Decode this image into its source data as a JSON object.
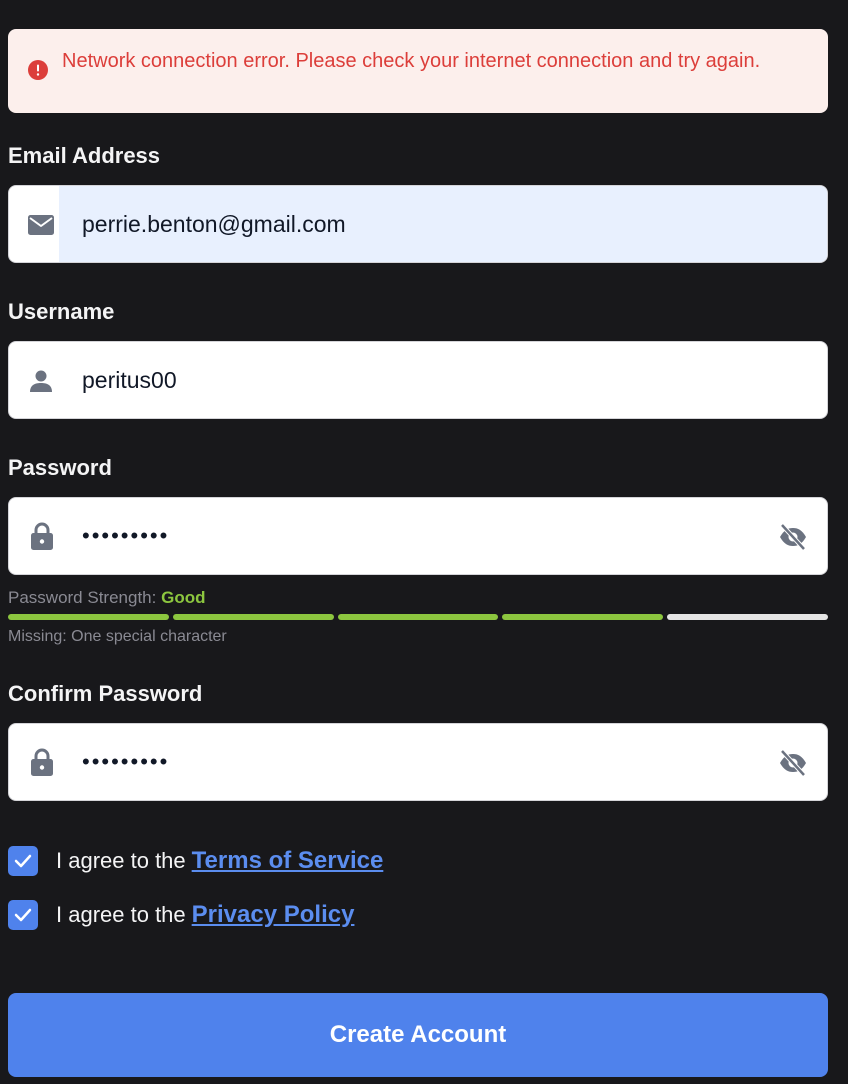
{
  "alert": {
    "message": "Network connection error. Please check your internet connection and try again.",
    "icon": "error-circle-icon",
    "color": "#dc3e3a",
    "background": "#fcefec"
  },
  "form": {
    "email": {
      "label": "Email Address",
      "value": "perrie.benton@gmail.com",
      "icon": "mail-icon"
    },
    "username": {
      "label": "Username",
      "value": "peritus00",
      "icon": "person-icon"
    },
    "password": {
      "label": "Password",
      "value": "•••••••••",
      "icon": "lock-icon",
      "toggle_icon": "eye-off-icon"
    },
    "strength": {
      "label": "Password Strength:",
      "value": "Good",
      "segments_total": 5,
      "segments_filled": 4,
      "missing": "Missing: One special character",
      "color": "#8cc63f"
    },
    "confirm_password": {
      "label": "Confirm Password",
      "value": "•••••••••",
      "icon": "lock-icon",
      "toggle_icon": "eye-off-icon"
    },
    "terms": {
      "checked": true,
      "prefix": "I agree to the",
      "link": "Terms of Service"
    },
    "privacy": {
      "checked": true,
      "prefix": "I agree to the",
      "link": "Privacy Policy"
    },
    "submit_label": "Create Account"
  },
  "theme": {
    "accent": "#4f82ec",
    "background": "#18181b"
  }
}
